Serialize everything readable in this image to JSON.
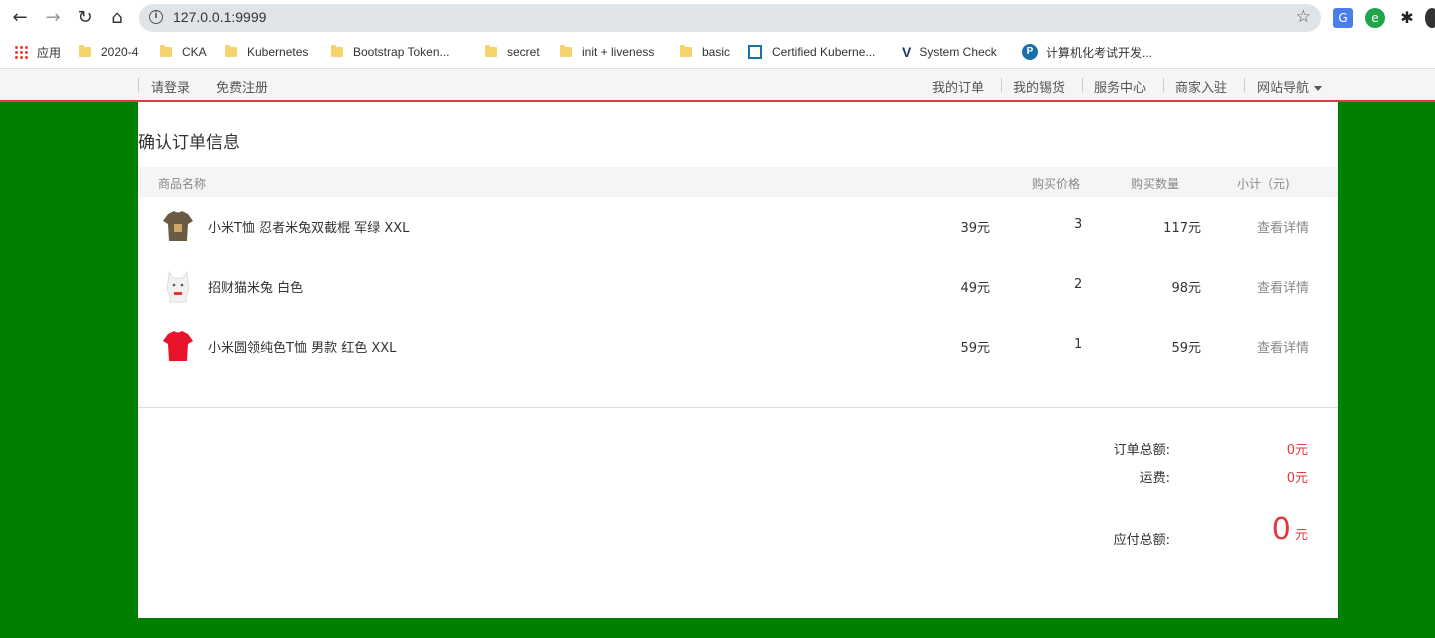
{
  "browser": {
    "url": "127.0.0.1:9999",
    "bookmarks": [
      "应用",
      "2020-4",
      "CKA",
      "Kubernetes",
      "Bootstrap Token...",
      "secret",
      "init + liveness",
      "basic",
      "Certified Kuberne...",
      "System Check",
      "计算机化考试开发..."
    ]
  },
  "topbar": {
    "login": "请登录",
    "register": "免费注册",
    "links": [
      "我的订单",
      "我的锡货",
      "服务中心",
      "商家入驻",
      "网站导航"
    ]
  },
  "order": {
    "title": "确认订单信息",
    "headers": {
      "name": "商品名称",
      "price": "购买价格",
      "qty": "购买数量",
      "subtotal": "小计（元)"
    },
    "items": [
      {
        "name": "小米T恤 忍者米兔双截棍 军绿 XXL",
        "price": "39元",
        "qty": "3",
        "subtotal": "117元",
        "action": "查看详情"
      },
      {
        "name": "招财猫米兔 白色",
        "price": "49元",
        "qty": "2",
        "subtotal": "98元",
        "action": "查看详情"
      },
      {
        "name": "小米圆领纯色T恤 男款 红色 XXL",
        "price": "59元",
        "qty": "1",
        "subtotal": "59元",
        "action": "查看详情"
      }
    ],
    "summary": {
      "total_label": "订单总额:",
      "total_value": "0元",
      "shipping_label": "运费:",
      "shipping_value": "0元",
      "payable_label": "应付总额:",
      "payable_number": "0",
      "payable_unit": "元"
    }
  },
  "colors": {
    "accent": "#e4393c",
    "page_bg": "#008000"
  }
}
